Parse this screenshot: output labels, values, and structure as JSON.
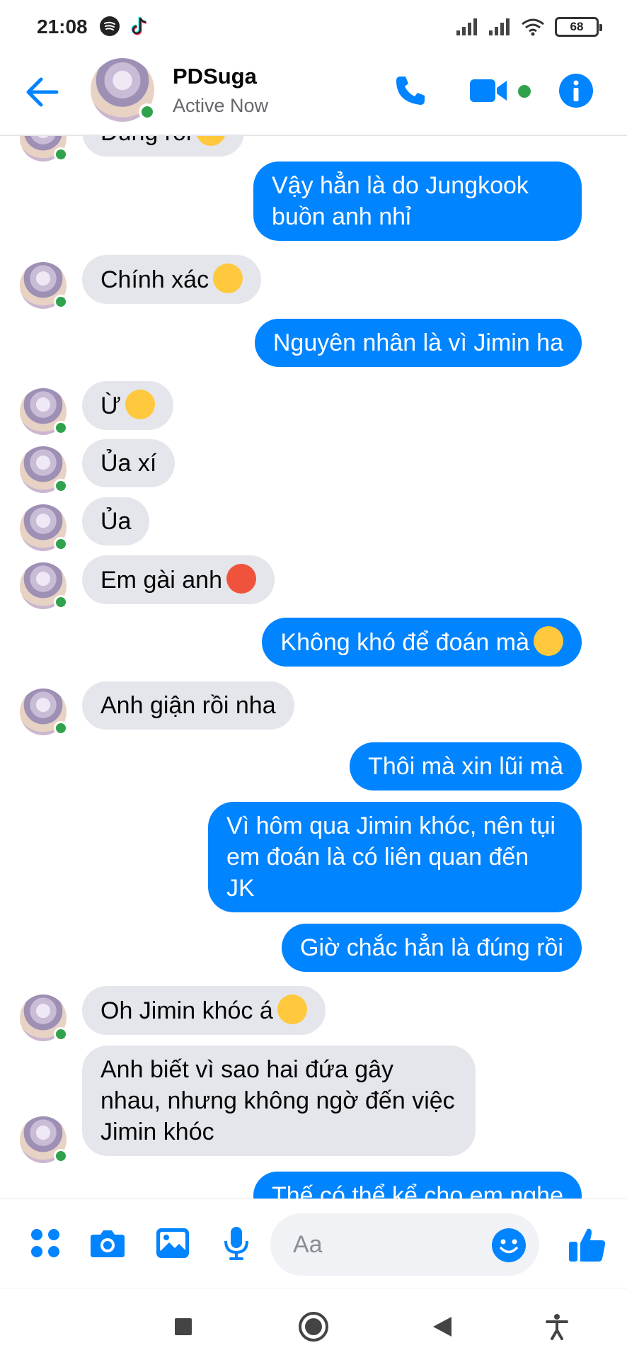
{
  "status_bar": {
    "time": "21:08",
    "battery": "68"
  },
  "header": {
    "contact_name": "PDSuga",
    "contact_status": "Active Now"
  },
  "messages": {
    "m0": "Đúng rồi",
    "m1a": "Vậy hẳn là do Jungkook",
    "m1b": "buồn anh nhỉ",
    "m2": "Chính xác",
    "m3": "Nguyên nhân là vì Jimin ha",
    "m4": "Ừ",
    "m5": "Ủa xí",
    "m6": "Ủa",
    "m7": "Em gài anh",
    "m8": "Không khó để đoán mà",
    "m9": "Anh giận rồi nha",
    "m10": "Thôi mà xin lũi mà",
    "m11": "Vì hôm qua Jimin khóc, nên tụi em đoán là có liên quan đến JK",
    "m12": "Giờ chắc hẳn là đúng rồi",
    "m13": "Oh Jimin khóc á",
    "m14": "Anh biết vì sao hai đứa gây nhau, nhưng không ngờ đến việc Jimin khóc",
    "m15": "Thế có thể kể cho em nghe"
  },
  "composer": {
    "placeholder": "Aa"
  },
  "colors": {
    "accent": "#0084ff",
    "incoming_bubble": "#e4e6eb",
    "online": "#31a24c"
  },
  "icons": {
    "header": [
      "back-arrow-icon",
      "phone-icon",
      "video-camera-icon",
      "info-icon"
    ],
    "composer": [
      "apps-grid-icon",
      "camera-icon",
      "gallery-icon",
      "microphone-icon",
      "emoji-icon",
      "thumbs-up-icon"
    ],
    "nav": [
      "recents-square-icon",
      "home-circle-icon",
      "back-triangle-icon",
      "accessibility-icon"
    ]
  }
}
